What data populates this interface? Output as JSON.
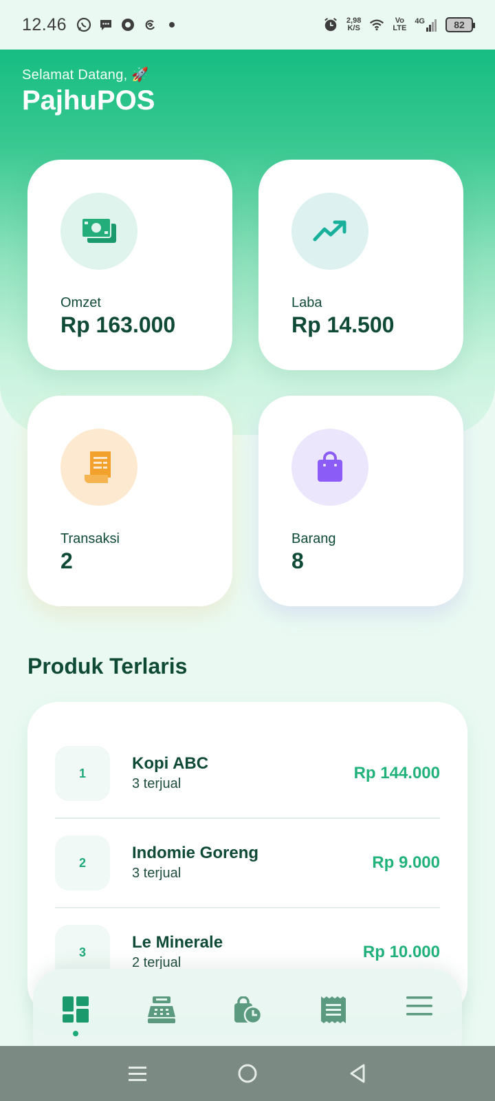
{
  "status_bar": {
    "time": "12.46",
    "net_speed_value": "2,98",
    "net_speed_unit": "K/S",
    "volte_top": "Vo",
    "volte_bottom": "LTE",
    "network": "4G",
    "battery": "82"
  },
  "header": {
    "greeting": "Selamat Datang, 🚀",
    "app_name": "PajhuPOS"
  },
  "stats": {
    "omzet": {
      "label": "Omzet",
      "value": "Rp 163.000"
    },
    "laba": {
      "label": "Laba",
      "value": "Rp 14.500"
    },
    "transaksi": {
      "label": "Transaksi",
      "value": "2"
    },
    "barang": {
      "label": "Barang",
      "value": "8"
    }
  },
  "best_sellers": {
    "title": "Produk Terlaris",
    "items": [
      {
        "rank": "1",
        "name": "Kopi ABC",
        "sold": "3 terjual",
        "price": "Rp 144.000"
      },
      {
        "rank": "2",
        "name": "Indomie Goreng",
        "sold": "3 terjual",
        "price": "Rp 9.000"
      },
      {
        "rank": "3",
        "name": "Le Minerale",
        "sold": "2 terjual",
        "price": "Rp 10.000"
      }
    ]
  },
  "bottom_nav": {
    "items": [
      "dashboard-icon",
      "cash-register-icon",
      "shopping-history-icon",
      "receipt-icon",
      "menu-icon"
    ],
    "active": "dashboard-icon"
  },
  "colors": {
    "primary": "#16bd82",
    "text_dark": "#0f4a36",
    "price_green": "#21b27c"
  }
}
